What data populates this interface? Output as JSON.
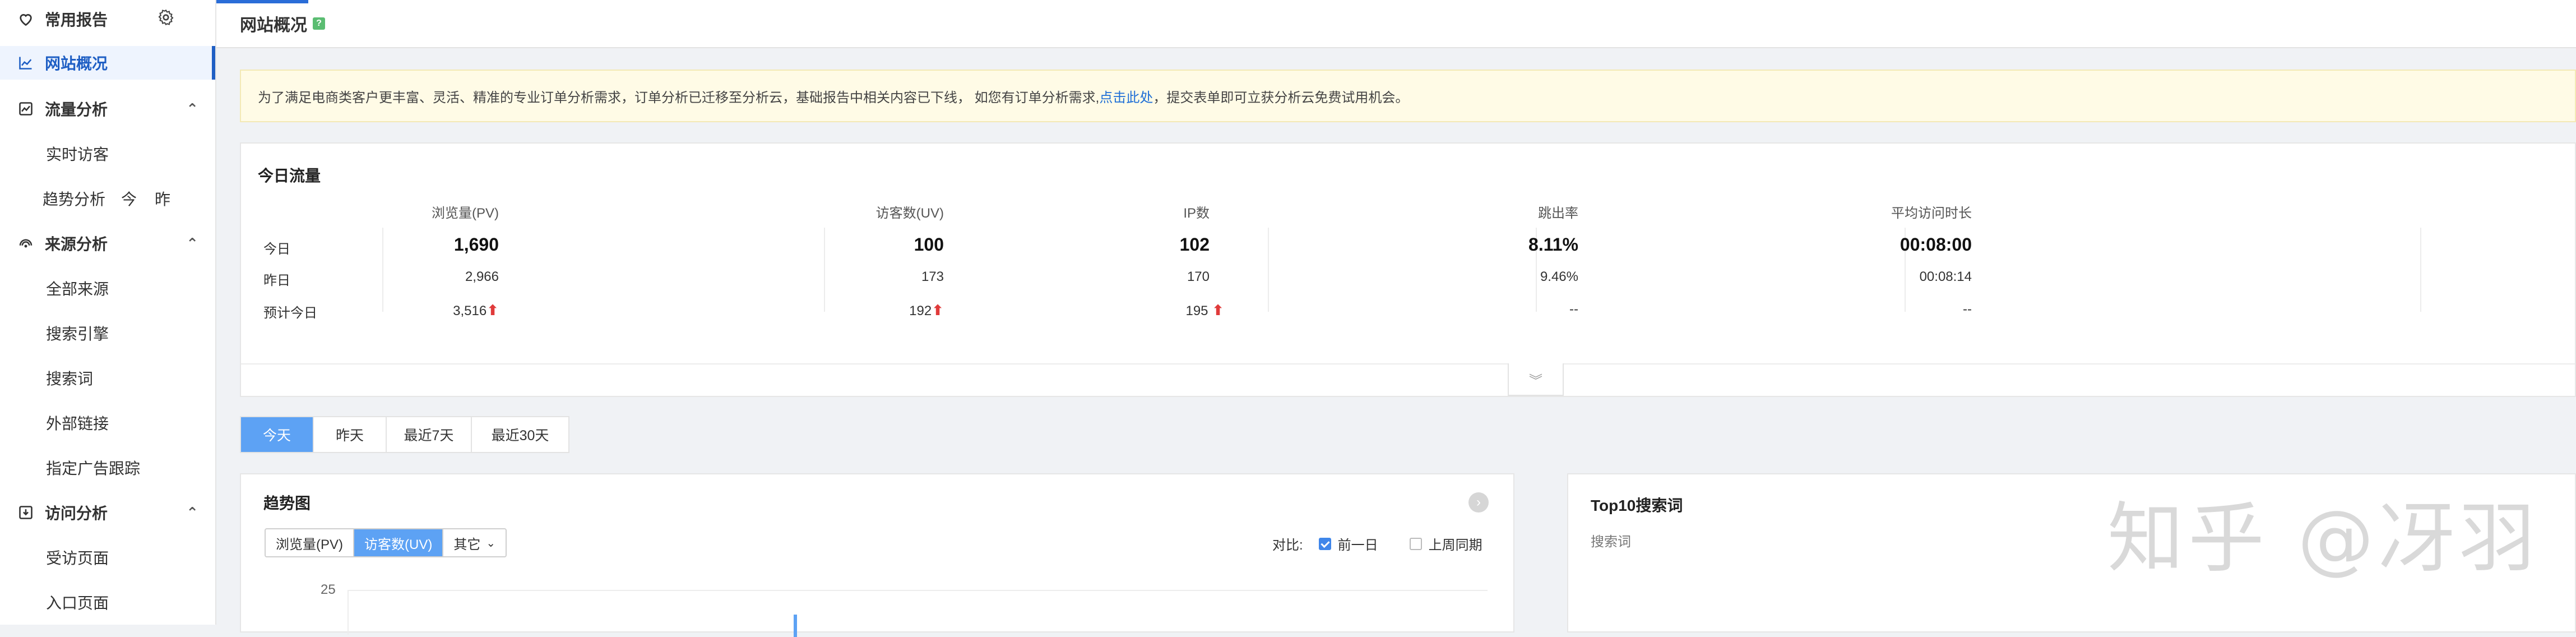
{
  "sidebar": {
    "favorites": {
      "label": "常用报告"
    },
    "site_overview": {
      "label": "网站概况"
    },
    "traffic": {
      "label": "流量分析",
      "items": [
        {
          "label": "实时访客"
        },
        {
          "label": "趋势分析",
          "extra": [
            "今",
            "昨"
          ]
        }
      ]
    },
    "source": {
      "label": "来源分析",
      "items": [
        {
          "label": "全部来源"
        },
        {
          "label": "搜索引擎"
        },
        {
          "label": "搜索词"
        },
        {
          "label": "外部链接"
        },
        {
          "label": "指定广告跟踪"
        }
      ]
    },
    "visit": {
      "label": "访问分析",
      "items": [
        {
          "label": "受访页面"
        },
        {
          "label": "入口页面"
        }
      ]
    }
  },
  "header": {
    "title": "网站概况",
    "badge": "?"
  },
  "notice": {
    "before": "为了满足电商类客户更丰富、灵活、精准的专业订单分析需求，订单分析已迁移至分析云，基础报告中相关内容已下线， 如您有订单分析需求,",
    "link": "点击此处",
    "after": "，提交表单即可立获分析云免费试用机会。"
  },
  "today": {
    "title": "今日流量",
    "headers": [
      "浏览量(PV)",
      "访客数(UV)",
      "IP数",
      "跳出率",
      "平均访问时长"
    ],
    "rows": [
      {
        "label": "今日",
        "values": [
          "1,690",
          "100",
          "102",
          "8.11%",
          "00:08:00"
        ]
      },
      {
        "label": "昨日",
        "values": [
          "2,966",
          "173",
          "170",
          "9.46%",
          "00:08:14"
        ]
      },
      {
        "label": "预计今日",
        "values": [
          "3,516",
          "192",
          "195",
          "--",
          "--"
        ]
      }
    ],
    "expand_icon": "chevron-double-down-icon"
  },
  "range_tabs": [
    "今天",
    "昨天",
    "最近7天",
    "最近30天"
  ],
  "trend": {
    "title": "趋势图",
    "metrics": [
      "浏览量(PV)",
      "访客数(UV)",
      "其它"
    ],
    "compare_label": "对比:",
    "compare_options": [
      {
        "label": "前一日",
        "checked": true
      },
      {
        "label": "上周同期",
        "checked": false
      }
    ],
    "y_tick": "25"
  },
  "top10": {
    "title": "Top10搜索词",
    "column": "搜索词"
  },
  "watermark": "知乎 @冴羽"
}
